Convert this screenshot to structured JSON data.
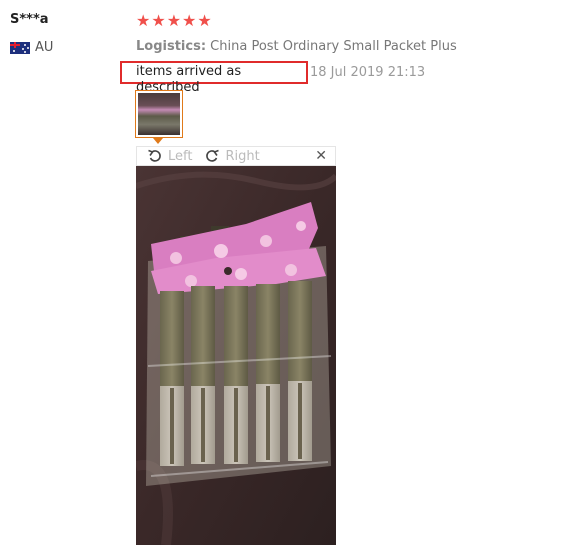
{
  "reviewer": {
    "name": "S***a",
    "country_code": "AU",
    "flag_icon": "australia-flag-icon"
  },
  "rating": {
    "stars": 5,
    "color": "#f0504b"
  },
  "logistics": {
    "label": "Logistics:",
    "value": "China Post Ordinary Small Packet Plus"
  },
  "review": {
    "text": "items arrived as described",
    "date": "18 Jul 2019 21:13"
  },
  "viewer": {
    "rotate_left_label": "Left",
    "rotate_right_label": "Right",
    "close_glyph": "✕"
  }
}
